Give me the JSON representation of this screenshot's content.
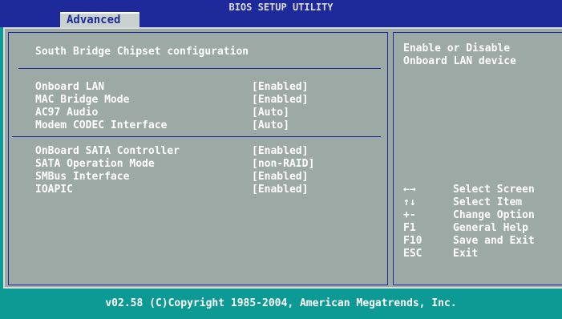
{
  "header": {
    "title": "BIOS SETUP UTILITY",
    "active_tab": "Advanced"
  },
  "main": {
    "section_title": "South Bridge Chipset configuration",
    "group1": [
      {
        "label": "Onboard LAN",
        "value": "[Enabled]"
      },
      {
        "label": "MAC Bridge Mode",
        "value": "[Enabled]"
      },
      {
        "label": "AC97 Audio",
        "value": "[Auto]"
      },
      {
        "label": "Modem CODEC Interface",
        "value": "[Auto]"
      }
    ],
    "group2": [
      {
        "label": "OnBoard SATA Controller",
        "value": "[Enabled]"
      },
      {
        "label": "SATA Operation Mode",
        "value": "[non-RAID]"
      },
      {
        "label": "SMBus Interface",
        "value": "[Enabled]"
      },
      {
        "label": "IOAPIC",
        "value": "[Enabled]"
      }
    ]
  },
  "help": {
    "line1": "Enable or Disable",
    "line2": "Onboard LAN device"
  },
  "keys": [
    {
      "key": "←→",
      "action": "Select Screen"
    },
    {
      "key": "↑↓",
      "action": "Select Item"
    },
    {
      "key": "+-",
      "action": "Change Option"
    },
    {
      "key": "F1",
      "action": "General Help"
    },
    {
      "key": "F10",
      "action": "Save and Exit"
    },
    {
      "key": "ESC",
      "action": "Exit"
    }
  ],
  "footer": {
    "text": "v02.58 (C)Copyright 1985-2004, American Megatrends, Inc."
  }
}
